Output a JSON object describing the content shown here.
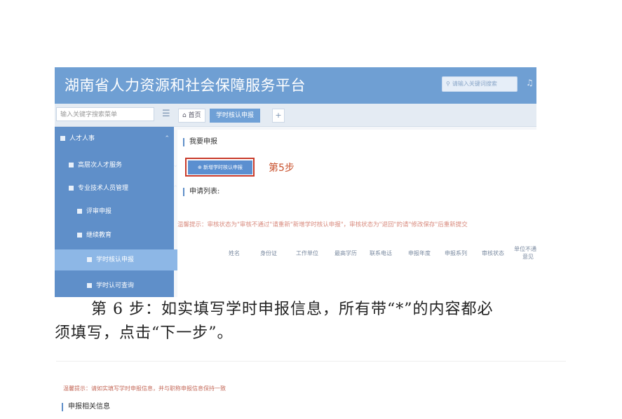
{
  "screenshot1": {
    "header": {
      "title": "湖南省人力资源和社会保障服务平台",
      "search_placeholder": "请输入关键词搜索",
      "search_icon": "search-icon",
      "bell_icon": "bell-icon"
    },
    "nav": {
      "menu_search_placeholder": "输入关键字搜索菜单",
      "menu_icon": "hamburger-icon",
      "home_tab": "首页",
      "active_tab": "学时核认申报",
      "add_tab": "+"
    },
    "sidebar": {
      "items": [
        {
          "label": "人才人事",
          "chevron": "⌃"
        },
        {
          "label": "高层次人才服务",
          "chevron": "⌄"
        },
        {
          "label": "专业技术人员管理",
          "chevron": "⌃"
        },
        {
          "label": "评审申报",
          "chevron": "⌄"
        },
        {
          "label": "继续教育",
          "chevron": "⌃"
        },
        {
          "label": "学时核认申报",
          "chevron": ""
        },
        {
          "label": "学时认可查询",
          "chevron": ""
        }
      ]
    },
    "main": {
      "section_title": "我要申报",
      "add_button": "⊕ 新增学时核认申报",
      "step_label": "第5步",
      "list_title": "申请列表:",
      "tip": "温馨提示：审核状态为\"审核不通过\"请重新\"新增学时核认申报\"，审核状态为\"退回\"的请\"修改保存\"后重新提交",
      "table_headers": [
        "姓名",
        "身份证",
        "工作单位",
        "最高学历",
        "联系电话",
        "申报年度",
        "申报系列",
        "审核状态",
        "单位不通过",
        "意见"
      ]
    }
  },
  "caption": {
    "line1": "第 6 步：如实填写学时申报信息，所有带“*”的内容都必",
    "line2": "须填写，点击“下一步”。"
  },
  "screenshot2": {
    "tip": "温馨提示：请如实填写学时申报信息，并与职称申报信息保持一致",
    "section_title": "申报相关信息"
  }
}
